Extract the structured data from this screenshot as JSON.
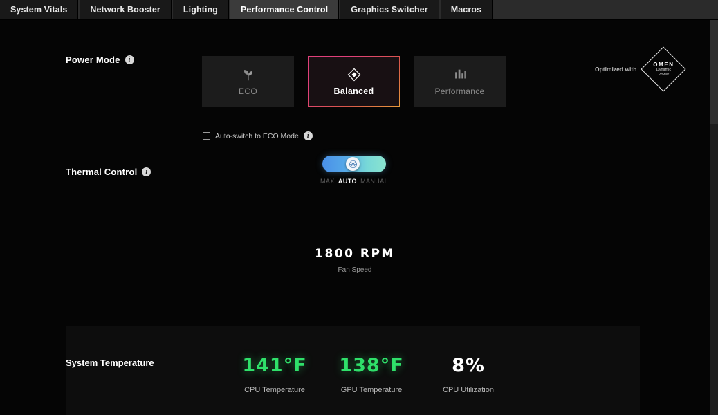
{
  "tabs": [
    {
      "label": "System Vitals",
      "active": false
    },
    {
      "label": "Network Booster",
      "active": false
    },
    {
      "label": "Lighting",
      "active": false
    },
    {
      "label": "Performance Control",
      "active": true
    },
    {
      "label": "Graphics Switcher",
      "active": false
    },
    {
      "label": "Macros",
      "active": false
    }
  ],
  "power_mode": {
    "title": "Power Mode",
    "info_glyph": "i",
    "modes": [
      {
        "label": "ECO",
        "icon": "leaf-icon",
        "selected": false
      },
      {
        "label": "Balanced",
        "icon": "diamond-icon",
        "selected": true
      },
      {
        "label": "Performance",
        "icon": "bar-chart-icon",
        "selected": false
      }
    ],
    "auto_switch": {
      "label": "Auto-switch to ECO Mode",
      "checked": false
    },
    "selected_accent_start": "#e0407a",
    "selected_accent_end": "#e89a3c"
  },
  "thermal_control": {
    "title": "Thermal Control",
    "info_glyph": "i",
    "slider": {
      "options": [
        "MAX",
        "AUTO",
        "MANUAL"
      ],
      "selected": "AUTO",
      "knob_icon": "fan-icon",
      "track_color_start": "#4a90e8",
      "track_color_end": "#8ae4cf"
    },
    "fan_speed": {
      "value": "1800 RPM",
      "label": "Fan Speed"
    }
  },
  "system_temperature": {
    "title": "System Temperature",
    "stats": [
      {
        "value": "141°F",
        "label": "CPU Temperature",
        "color": "#2fe06a"
      },
      {
        "value": "138°F",
        "label": "GPU Temperature",
        "color": "#2fe06a"
      },
      {
        "value": "8%",
        "label": "CPU Utilization",
        "color": "#ffffff"
      }
    ]
  },
  "omen_badge": {
    "prefix": "Optimized with",
    "brand": "OMEN",
    "line2": "Dynamic",
    "line3": "Power"
  }
}
